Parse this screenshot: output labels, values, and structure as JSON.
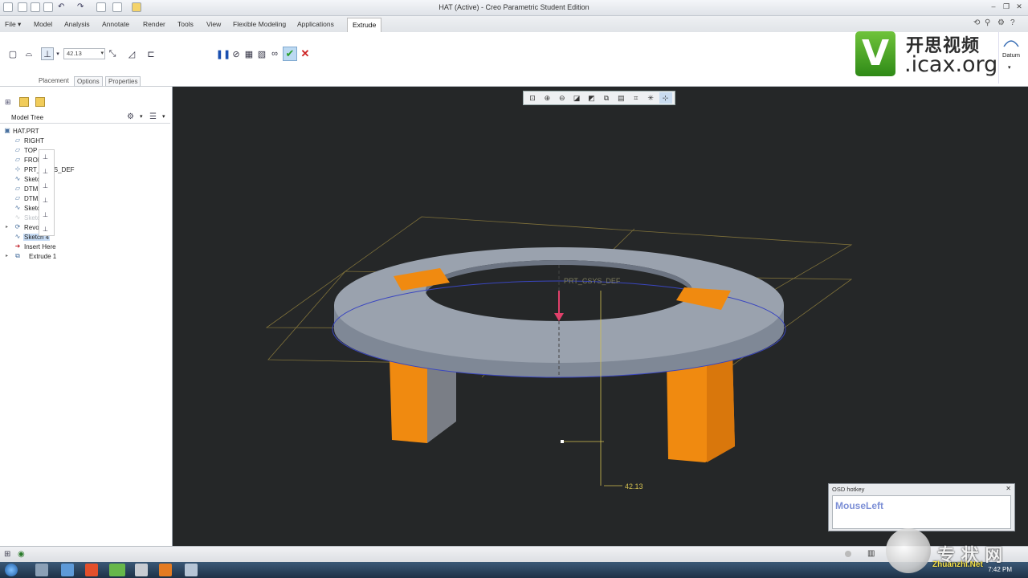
{
  "window": {
    "title": "HAT (Active) - Creo Parametric Student Edition"
  },
  "tabs": [
    {
      "label": "File ▾"
    },
    {
      "label": "Model"
    },
    {
      "label": "Analysis"
    },
    {
      "label": "Annotate"
    },
    {
      "label": "Render"
    },
    {
      "label": "Tools"
    },
    {
      "label": "View"
    },
    {
      "label": "Flexible Modeling"
    },
    {
      "label": "Applications"
    },
    {
      "label": "Extrude"
    }
  ],
  "ribbon": {
    "depth_value": "42.13",
    "subtabs": [
      "Placement",
      "Options",
      "Properties"
    ],
    "datum_label": "Datum"
  },
  "logo": {
    "cn": "开思视频",
    "domain": ".icax.org",
    "letter": "V"
  },
  "model_tree": {
    "title": "Model Tree",
    "items": [
      {
        "label": "HAT.PRT",
        "icon": "part-icon"
      },
      {
        "label": "RIGHT",
        "icon": "datum-plane-icon"
      },
      {
        "label": "TOP",
        "icon": "datum-plane-icon"
      },
      {
        "label": "FRONT",
        "icon": "datum-plane-icon"
      },
      {
        "label": "PRT_CSYS_DEF",
        "icon": "csys-icon"
      },
      {
        "label": "Sketch 1",
        "icon": "sketch-icon"
      },
      {
        "label": "DTM1",
        "icon": "datum-plane-icon"
      },
      {
        "label": "DTM2",
        "icon": "datum-plane-icon"
      },
      {
        "label": "Sketch 2",
        "icon": "sketch-icon"
      },
      {
        "label": "Sketch 3",
        "icon": "sketch-icon"
      },
      {
        "label": "Revolve 1",
        "icon": "revolve-icon"
      },
      {
        "label": "Sketch 4",
        "icon": "sketch-icon"
      },
      {
        "label": "Insert Here",
        "icon": "insert-arrow-icon"
      },
      {
        "label": "Extrude 1",
        "icon": "extrude-icon"
      }
    ]
  },
  "viewport": {
    "csys_label": "PRT_CSYS_DEF",
    "dimension_value": "42.13"
  },
  "osd": {
    "title": "OSD hotkey",
    "key": "MouseLeft"
  },
  "taskbar": {
    "clock": "7:42 PM"
  },
  "watermark": {
    "cn": "专 状 网",
    "en": "Zhuanzhi.Net"
  },
  "colors": {
    "accent_orange": "#f08a10",
    "viewport_bg": "#252728",
    "ring_gray": "#8e97a6",
    "ok_green": "#2aa02a",
    "cancel_red": "#cc2222"
  }
}
